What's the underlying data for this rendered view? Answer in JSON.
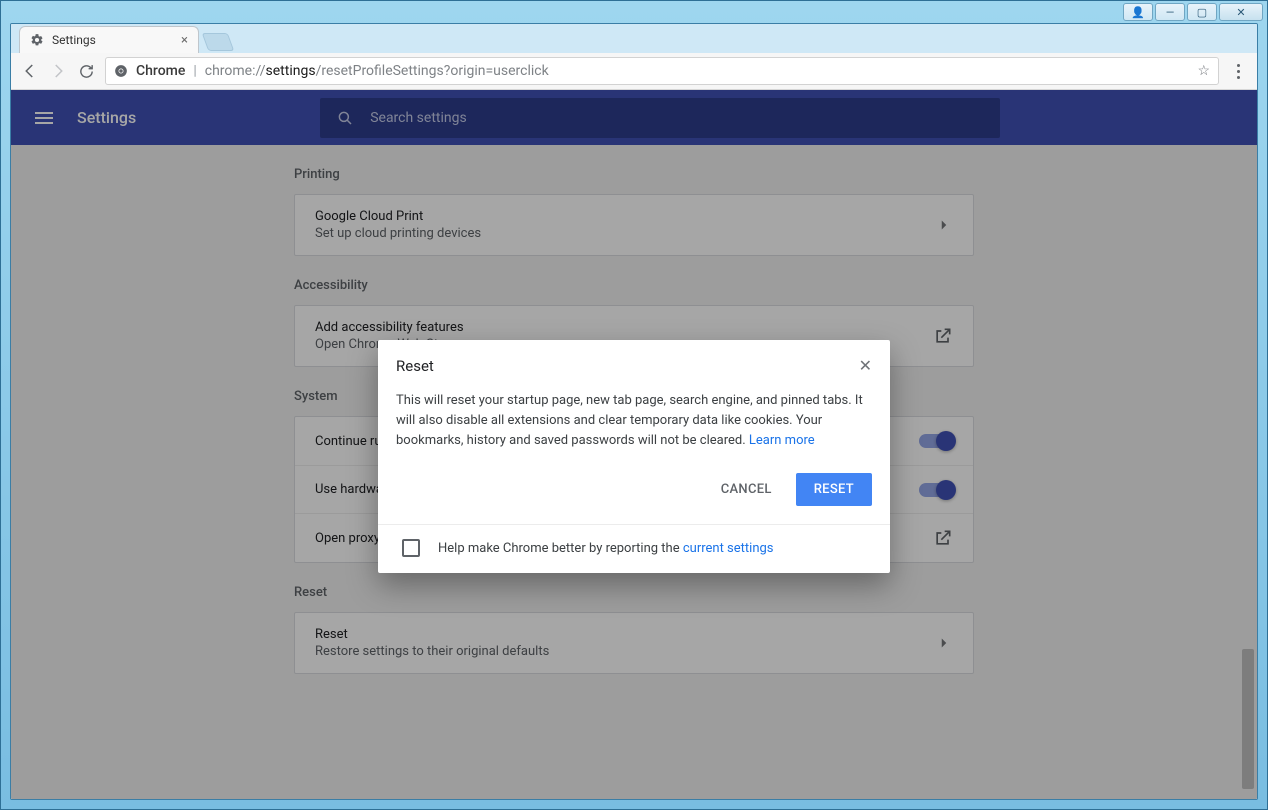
{
  "window_controls": {
    "user": "👤",
    "minimize": "—",
    "maximize": "▢",
    "close": "✕"
  },
  "tab": {
    "title": "Settings"
  },
  "omnibox": {
    "origin_label": "Chrome",
    "url_scheme": "chrome://",
    "url_bold": "settings",
    "url_rest": "/resetProfileSettings?origin=userclick"
  },
  "header": {
    "title": "Settings",
    "search_placeholder": "Search settings"
  },
  "sections": {
    "printing": {
      "label": "Printing",
      "row_title": "Google Cloud Print",
      "row_sub": "Set up cloud printing devices"
    },
    "accessibility": {
      "label": "Accessibility",
      "row_title": "Add accessibility features",
      "row_sub": "Open Chrome Web Store"
    },
    "system": {
      "label": "System",
      "row1": "Continue running background apps when Google Chrome is closed",
      "row2": "Use hardware acceleration when available",
      "row3": "Open proxy settings"
    },
    "reset": {
      "label": "Reset",
      "row_title": "Reset",
      "row_sub": "Restore settings to their original defaults"
    }
  },
  "dialog": {
    "title": "Reset",
    "body_text": "This will reset your startup page, new tab page, search engine, and pinned tabs. It will also disable all extensions and clear temporary data like cookies. Your bookmarks, history and saved passwords will not be cleared. ",
    "learn_more": "Learn more",
    "cancel": "CANCEL",
    "confirm": "RESET",
    "footer_text": "Help make Chrome better by reporting the ",
    "footer_link": "current settings"
  }
}
